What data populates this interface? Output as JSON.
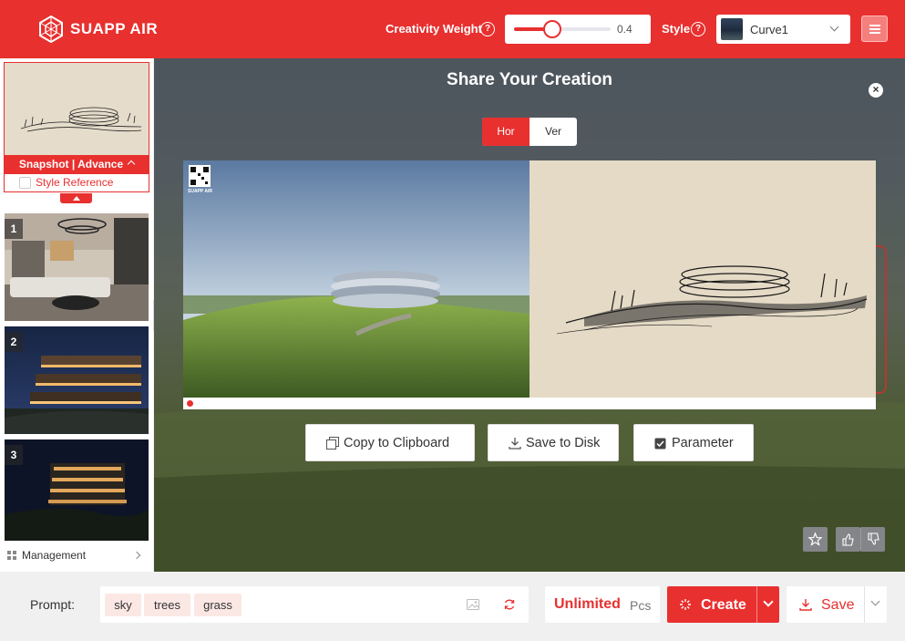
{
  "header": {
    "brand": "SUAPP AIR",
    "creativity_label": "Creativity Weight",
    "creativity_value": "0.4",
    "creativity_fraction": 0.4,
    "style_label": "Style",
    "style_selected": "Curve1",
    "help_glyph": "?"
  },
  "sidebar": {
    "snapshot_label": "Snapshot | Advance",
    "style_reference_label": "Style Reference",
    "style_reference_checked": false,
    "thumbnails": [
      {
        "num": "1",
        "desc": "interior"
      },
      {
        "num": "2",
        "desc": "night-building"
      },
      {
        "num": "3",
        "desc": "night-apartments"
      }
    ],
    "management_label": "Management"
  },
  "share": {
    "title": "Share Your Creation",
    "close_glyph": "×",
    "orientation": {
      "hor": "Hor",
      "ver": "Ver",
      "selected": "Hor"
    },
    "qr_caption": "SUAPP AIR",
    "actions": {
      "copy": "Copy to Clipboard",
      "save": "Save to Disk",
      "parameter": "Parameter"
    }
  },
  "bottom": {
    "prompt_label": "Prompt:",
    "tags": [
      "sky",
      "trees",
      "grass"
    ],
    "quota_value": "Unlimited",
    "quota_unit": "Pcs",
    "create_label": "Create",
    "save_label": "Save"
  },
  "colors": {
    "accent": "#e8302f",
    "chip_bg": "#fbe8e4"
  },
  "icons": {
    "logo": "suapp-logo-icon",
    "help": "help-circle-icon",
    "menu": "hamburger-menu-icon",
    "copy": "copy-icon",
    "download": "download-icon",
    "checkbox": "checkbox-checked-icon",
    "star": "star-icon",
    "thumbs_up": "thumbs-up-icon",
    "thumbs_down": "thumbs-down-icon",
    "image": "image-icon",
    "refresh": "refresh-icon",
    "sparkle": "sparkle-icon"
  }
}
